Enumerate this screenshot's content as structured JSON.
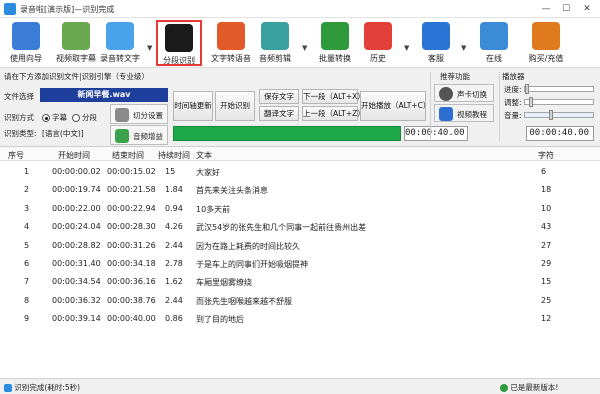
{
  "window": {
    "title": "录音啦[演示版]—识别完成",
    "min": "—",
    "max": "☐",
    "close": "✕"
  },
  "toolbar": [
    {
      "label": "使用向导",
      "icon": "upload-arrow-icon",
      "color": "#3c7dd9"
    },
    {
      "label": "视频取字幕",
      "icon": "film-icon",
      "color": "#6aa84f"
    },
    {
      "label": "录音转文字",
      "icon": "wave-w-icon",
      "color": "#4aa3e8"
    },
    {
      "label": "分段识别",
      "icon": "sound-bars-icon",
      "color": "#1a1a1a"
    },
    {
      "label": "文字转语音",
      "icon": "megaphone-icon",
      "color": "#e05a2a"
    },
    {
      "label": "音频剪辑",
      "icon": "scissors-icon",
      "color": "#3aa0a0"
    },
    {
      "label": "批量转换",
      "icon": "shuffle-icon",
      "color": "#2e9a3c"
    },
    {
      "label": "历史",
      "icon": "history-clock-icon",
      "color": "#e2403a"
    },
    {
      "label": "客服",
      "icon": "help-icon",
      "color": "#2a74d6"
    },
    {
      "label": "在线",
      "icon": "user-online-icon",
      "color": "#3c8bd6"
    },
    {
      "label": "购买/充值",
      "icon": "dollar-clock-icon",
      "color": "#e07a1f"
    }
  ],
  "left_panel": {
    "header": "请在下方添加识别文件|识别引擎（专业级）",
    "file_label": "文件选择",
    "file_value": "新闻早餐.wav",
    "mode_label": "识别方式",
    "mode_opt1": "字幕",
    "mode_opt2": "分段",
    "type_label": "识别类型:",
    "type_value": "[语言(中文)]",
    "cut_settings": "切分设置",
    "audio_boost": "音频增益"
  },
  "mid_buttons": {
    "timeline_update": "时间轴更新",
    "start_recognize": "开始识别",
    "save_text": "保存文字",
    "translate_text": "翻译文字",
    "next_segment": "下一段（ALT+X）",
    "prev_segment": "上一段（ALT+Z）",
    "start_play": "开始播放（ALT+C）"
  },
  "recommend": {
    "title": "推荐功能",
    "voice_switch": "声卡切换",
    "video_tutorial": "视频教程"
  },
  "player": {
    "title": "播放器",
    "progress_label": "进度:",
    "adjust_label": "调整:",
    "volume_label": "音量:"
  },
  "times": {
    "current": "00:00:40.00",
    "total": "00:00:40.00"
  },
  "table": {
    "headers": [
      "序号",
      "开始时间",
      "结束时间",
      "持续时间",
      "文本",
      "字符"
    ],
    "rows": [
      [
        "1",
        "00:00:00.02",
        "00:00:15.02",
        "15",
        "大家好",
        "6"
      ],
      [
        "2",
        "00:00:19.74",
        "00:00:21.58",
        "1.84",
        "首先来关注头条消息",
        "18"
      ],
      [
        "3",
        "00:00:22.00",
        "00:00:22.94",
        "0.94",
        "10多天前",
        "10"
      ],
      [
        "4",
        "00:00:24.04",
        "00:00:28.30",
        "4.26",
        "武汉54岁的张先生和几个同事一起前往贵州出差",
        "43"
      ],
      [
        "5",
        "00:00:28.82",
        "00:00:31.26",
        "2.44",
        "因为在路上耗费的时间比较久",
        "27"
      ],
      [
        "6",
        "00:00:31.40",
        "00:00:34.18",
        "2.78",
        "于是车上的同事们开始吸烟提神",
        "29"
      ],
      [
        "7",
        "00:00:34.54",
        "00:00:36.16",
        "1.62",
        "车厢里烟雾缭绕",
        "15"
      ],
      [
        "8",
        "00:00:36.32",
        "00:00:38.76",
        "2.44",
        "而张先生咽喉越来越不舒服",
        "25"
      ],
      [
        "9",
        "00:00:39.14",
        "00:00:40.00",
        "0.86",
        "到了目的地后",
        "12"
      ]
    ]
  },
  "status": {
    "left": "识别完成(耗时:5秒)",
    "right": "已是最新版本!"
  }
}
